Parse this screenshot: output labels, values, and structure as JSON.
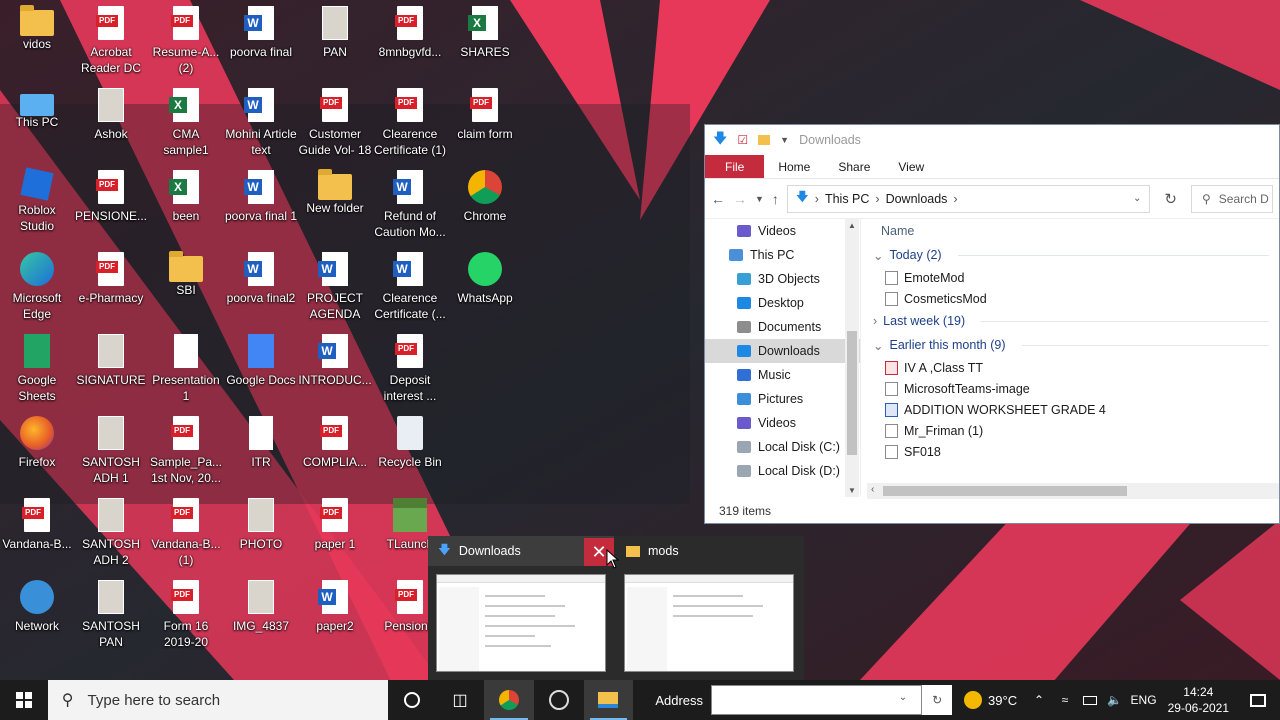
{
  "desktop_icons": [
    {
      "label": "vidos",
      "type": "folder",
      "col": 0,
      "row": 0
    },
    {
      "label": "Acrobat Reader DC",
      "type": "pdf",
      "col": 1,
      "row": 0
    },
    {
      "label": "Resume-A... (2)",
      "type": "pdf",
      "col": 2,
      "row": 0
    },
    {
      "label": "poorva final",
      "type": "word",
      "col": 3,
      "row": 0
    },
    {
      "label": "PAN",
      "type": "img",
      "col": 4,
      "row": 0
    },
    {
      "label": "8mnbgvfd...",
      "type": "pdf",
      "col": 5,
      "row": 0
    },
    {
      "label": "SHARES",
      "type": "xls",
      "col": 6,
      "row": 0
    },
    {
      "label": "This PC",
      "type": "pc",
      "col": 0,
      "row": 1
    },
    {
      "label": "Ashok",
      "type": "img",
      "col": 1,
      "row": 1
    },
    {
      "label": "CMA sample1 201920",
      "type": "xls",
      "col": 2,
      "row": 1
    },
    {
      "label": "Mohini Article text",
      "type": "word",
      "col": 3,
      "row": 1
    },
    {
      "label": "Customer Guide Vol- 18",
      "type": "pdf",
      "col": 4,
      "row": 1
    },
    {
      "label": "Clearence Certificate (1)",
      "type": "pdf",
      "col": 5,
      "row": 1
    },
    {
      "label": "claim form",
      "type": "pdf",
      "col": 6,
      "row": 1
    },
    {
      "label": "Roblox Studio",
      "type": "roblox",
      "col": 0,
      "row": 2
    },
    {
      "label": "PENSIONE...",
      "type": "pdf",
      "col": 1,
      "row": 2
    },
    {
      "label": "been",
      "type": "xls",
      "col": 2,
      "row": 2
    },
    {
      "label": "poorva final 1",
      "type": "word",
      "col": 3,
      "row": 2
    },
    {
      "label": "New folder",
      "type": "folder",
      "col": 4,
      "row": 2
    },
    {
      "label": "Refund of Caution Mo...",
      "type": "word",
      "col": 5,
      "row": 2
    },
    {
      "label": "Chrome",
      "type": "chrome",
      "col": 6,
      "row": 2
    },
    {
      "label": "Microsoft Edge",
      "type": "edge",
      "col": 0,
      "row": 3
    },
    {
      "label": "e-Pharmacy",
      "type": "pdf",
      "col": 1,
      "row": 3
    },
    {
      "label": "SBI",
      "type": "folder",
      "col": 2,
      "row": 3
    },
    {
      "label": "poorva final2",
      "type": "word",
      "col": 3,
      "row": 3
    },
    {
      "label": "PROJECT AGENDA",
      "type": "word",
      "col": 4,
      "row": 3
    },
    {
      "label": "Clearence Certificate (...",
      "type": "word",
      "col": 5,
      "row": 3
    },
    {
      "label": "WhatsApp",
      "type": "whatsapp",
      "col": 6,
      "row": 3
    },
    {
      "label": "Google Sheets",
      "type": "gsheets",
      "col": 0,
      "row": 4
    },
    {
      "label": "SIGNATURE",
      "type": "img",
      "col": 1,
      "row": 4
    },
    {
      "label": "Presentation1",
      "type": "blank",
      "col": 2,
      "row": 4
    },
    {
      "label": "Google Docs",
      "type": "gdocs",
      "col": 3,
      "row": 4
    },
    {
      "label": "INTRODUC...",
      "type": "word",
      "col": 4,
      "row": 4
    },
    {
      "label": "Deposit interest ...",
      "type": "pdf",
      "col": 5,
      "row": 4
    },
    {
      "label": "Firefox",
      "type": "firefox",
      "col": 0,
      "row": 5
    },
    {
      "label": "SANTOSH ADH 1",
      "type": "img",
      "col": 1,
      "row": 5
    },
    {
      "label": "Sample_Pa... 1st Nov, 20...",
      "type": "pdf",
      "col": 2,
      "row": 5
    },
    {
      "label": "ITR",
      "type": "blank",
      "col": 3,
      "row": 5
    },
    {
      "label": "COMPLIA...",
      "type": "pdf",
      "col": 4,
      "row": 5
    },
    {
      "label": "Recycle Bin",
      "type": "recycle",
      "col": 5,
      "row": 5
    },
    {
      "label": "Vandana-B...",
      "type": "pdf",
      "col": 0,
      "row": 6
    },
    {
      "label": "SANTOSH ADH 2",
      "type": "img",
      "col": 1,
      "row": 6
    },
    {
      "label": "Vandana-B... (1)",
      "type": "pdf",
      "col": 2,
      "row": 6
    },
    {
      "label": "PHOTO",
      "type": "img",
      "col": 3,
      "row": 6
    },
    {
      "label": "paper 1",
      "type": "pdf",
      "col": 4,
      "row": 6
    },
    {
      "label": "TLaunch",
      "type": "minecraft",
      "col": 5,
      "row": 6
    },
    {
      "label": "Network",
      "type": "network",
      "col": 0,
      "row": 7
    },
    {
      "label": "SANTOSH PAN",
      "type": "img",
      "col": 1,
      "row": 7
    },
    {
      "label": "Form 16 2019-20",
      "type": "pdf",
      "col": 2,
      "row": 7
    },
    {
      "label": "IMG_4837",
      "type": "img",
      "col": 3,
      "row": 7
    },
    {
      "label": "paper2",
      "type": "word",
      "col": 4,
      "row": 7
    },
    {
      "label": "PensionS",
      "type": "pdf",
      "col": 5,
      "row": 7
    }
  ],
  "explorer": {
    "title": "Downloads",
    "ribbon": [
      "File",
      "Home",
      "Share",
      "View"
    ],
    "breadcrumb": [
      "This PC",
      "Downloads"
    ],
    "search_placeholder": "Search D",
    "nav": [
      {
        "label": "Videos",
        "color": "#6a5acd",
        "indent": 1
      },
      {
        "label": "This PC",
        "color": "#4a90d9",
        "indent": 0
      },
      {
        "label": "3D Objects",
        "color": "#39a0d6",
        "indent": 1
      },
      {
        "label": "Desktop",
        "color": "#1e88e5",
        "indent": 1
      },
      {
        "label": "Documents",
        "color": "#8d8d8d",
        "indent": 1
      },
      {
        "label": "Downloads",
        "color": "#1e88e5",
        "indent": 1,
        "selected": true
      },
      {
        "label": "Music",
        "color": "#2f6fd6",
        "indent": 1
      },
      {
        "label": "Pictures",
        "color": "#3b8fd9",
        "indent": 1
      },
      {
        "label": "Videos",
        "color": "#6a5acd",
        "indent": 1
      },
      {
        "label": "Local Disk (C:)",
        "color": "#9aa6b2",
        "indent": 1
      },
      {
        "label": "Local Disk (D:)",
        "color": "#9aa6b2",
        "indent": 1
      }
    ],
    "column_header": "Name",
    "groups": [
      {
        "label": "Today (2)",
        "expanded": true,
        "items": [
          {
            "name": "EmoteMod",
            "type": "file"
          },
          {
            "name": "CosmeticsMod",
            "type": "file"
          }
        ]
      },
      {
        "label": "Last week (19)",
        "expanded": false,
        "items": []
      },
      {
        "label": "Earlier this month (9)",
        "expanded": true,
        "items": [
          {
            "name": "IV A ,Class TT",
            "type": "pdf"
          },
          {
            "name": "MicrosoftTeams-image",
            "type": "file"
          },
          {
            "name": "ADDITION WORKSHEET GRADE 4",
            "type": "w"
          },
          {
            "name": "Mr_Friman (1)",
            "type": "file"
          },
          {
            "name": "SF018",
            "type": "file"
          }
        ]
      }
    ],
    "status": "319 items"
  },
  "thumbnails": [
    {
      "title": "Downloads"
    },
    {
      "title": "mods"
    }
  ],
  "taskbar": {
    "search_placeholder": "Type here to search",
    "address_label": "Address",
    "weather": "39°C",
    "language": "ENG",
    "time": "14:24",
    "date": "29-06-2021"
  }
}
